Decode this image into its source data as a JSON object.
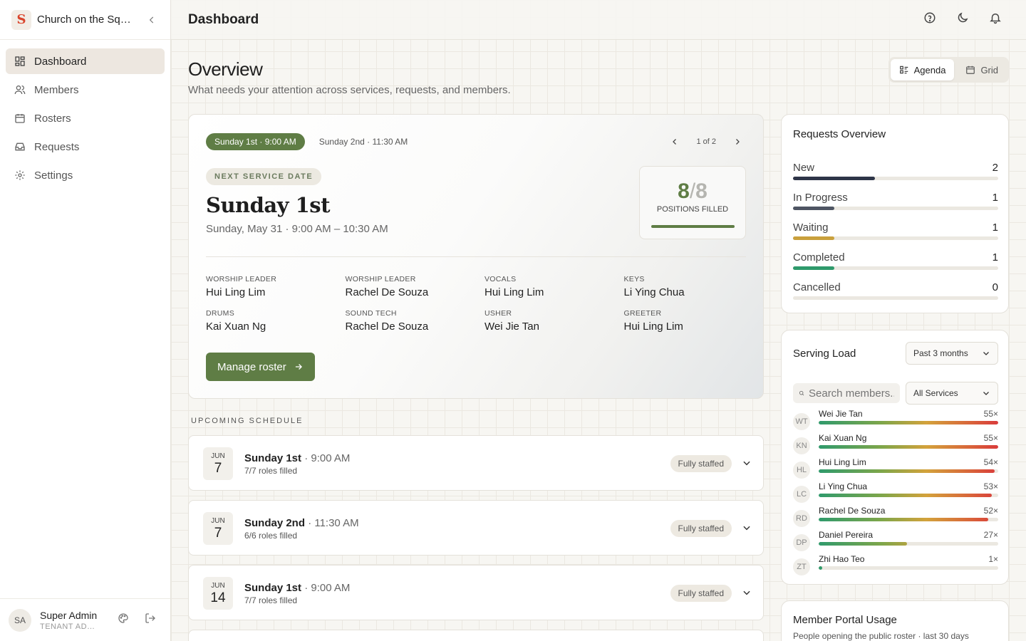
{
  "app": {
    "church_name": "Church on the Square",
    "logo_letter": "S",
    "accent": "#5f7d45"
  },
  "sidebar": {
    "items": [
      {
        "label": "Dashboard",
        "icon": "dashboard-icon",
        "active": true
      },
      {
        "label": "Members",
        "icon": "users-icon",
        "active": false
      },
      {
        "label": "Rosters",
        "icon": "calendar-icon",
        "active": false
      },
      {
        "label": "Requests",
        "icon": "inbox-icon",
        "active": false
      },
      {
        "label": "Settings",
        "icon": "gear-icon",
        "active": false
      }
    ],
    "user": {
      "initials": "SA",
      "name": "Super Admin",
      "role": "TENANT ADMIN"
    }
  },
  "header": {
    "title": "Dashboard"
  },
  "overview": {
    "title": "Overview",
    "subtitle": "What needs your attention across services, requests, and members.",
    "views": [
      "Agenda",
      "Grid"
    ],
    "active_view": "Agenda"
  },
  "service": {
    "chips": [
      "Sunday 1st · 9:00 AM",
      "Sunday 2nd · 11:30 AM"
    ],
    "pager": "1 of 2",
    "tag": "NEXT SERVICE DATE",
    "name": "Sunday 1st",
    "datetime": "Sunday, May 31 · 9:00 AM – 10:30 AM",
    "filled": "8",
    "slash": "/",
    "total": "8",
    "filled_label": "POSITIONS FILLED",
    "filled_fraction": 1.0,
    "roles": [
      {
        "role": "WORSHIP LEADER",
        "person": "Hui Ling Lim"
      },
      {
        "role": "WORSHIP LEADER",
        "person": "Rachel De Souza"
      },
      {
        "role": "VOCALS",
        "person": "Hui Ling Lim"
      },
      {
        "role": "KEYS",
        "person": "Li Ying Chua"
      },
      {
        "role": "DRUMS",
        "person": "Kai Xuan Ng"
      },
      {
        "role": "SOUND TECH",
        "person": "Rachel De Souza"
      },
      {
        "role": "USHER",
        "person": "Wei Jie Tan"
      },
      {
        "role": "GREETER",
        "person": "Hui Ling Lim"
      }
    ],
    "manage_label": "Manage roster"
  },
  "upcoming": {
    "label": "UPCOMING SCHEDULE",
    "items": [
      {
        "month": "JUN",
        "day": "7",
        "name": "Sunday 1st",
        "time": "· 9:00 AM",
        "roles": "7/7 roles filled",
        "status": "Fully staffed"
      },
      {
        "month": "JUN",
        "day": "7",
        "name": "Sunday 2nd",
        "time": "· 11:30 AM",
        "roles": "6/6 roles filled",
        "status": "Fully staffed"
      },
      {
        "month": "JUN",
        "day": "14",
        "name": "Sunday 1st",
        "time": "· 9:00 AM",
        "roles": "7/7 roles filled",
        "status": "Fully staffed"
      }
    ]
  },
  "requests": {
    "title": "Requests Overview",
    "rows": [
      {
        "label": "New",
        "count": "2",
        "fraction": 0.4,
        "color": "#2e3548"
      },
      {
        "label": "In Progress",
        "count": "1",
        "fraction": 0.2,
        "color": "#4e5563"
      },
      {
        "label": "Waiting",
        "count": "1",
        "fraction": 0.2,
        "color": "#c9a03c"
      },
      {
        "label": "Completed",
        "count": "1",
        "fraction": 0.2,
        "color": "#2f9a6c"
      },
      {
        "label": "Cancelled",
        "count": "0",
        "fraction": 0,
        "color": "#b3b3b3"
      }
    ]
  },
  "serving_load": {
    "title": "Serving Load",
    "period": "Past 3 months",
    "search_placeholder": "Search members...",
    "service_filter": "All Services",
    "members": [
      {
        "initials": "WT",
        "name": "Wei Jie Tan",
        "count": "55×",
        "fraction": 1.0
      },
      {
        "initials": "KN",
        "name": "Kai Xuan Ng",
        "count": "55×",
        "fraction": 1.0
      },
      {
        "initials": "HL",
        "name": "Hui Ling Lim",
        "count": "54×",
        "fraction": 0.982
      },
      {
        "initials": "LC",
        "name": "Li Ying Chua",
        "count": "53×",
        "fraction": 0.964
      },
      {
        "initials": "RD",
        "name": "Rachel De Souza",
        "count": "52×",
        "fraction": 0.945
      },
      {
        "initials": "DP",
        "name": "Daniel Pereira",
        "count": "27×",
        "fraction": 0.491
      },
      {
        "initials": "ZT",
        "name": "Zhi Hao Teo",
        "count": "1×",
        "fraction": 0.018
      }
    ]
  },
  "portal": {
    "title": "Member Portal Usage",
    "subtitle": "People opening the public roster · last 30 days"
  }
}
